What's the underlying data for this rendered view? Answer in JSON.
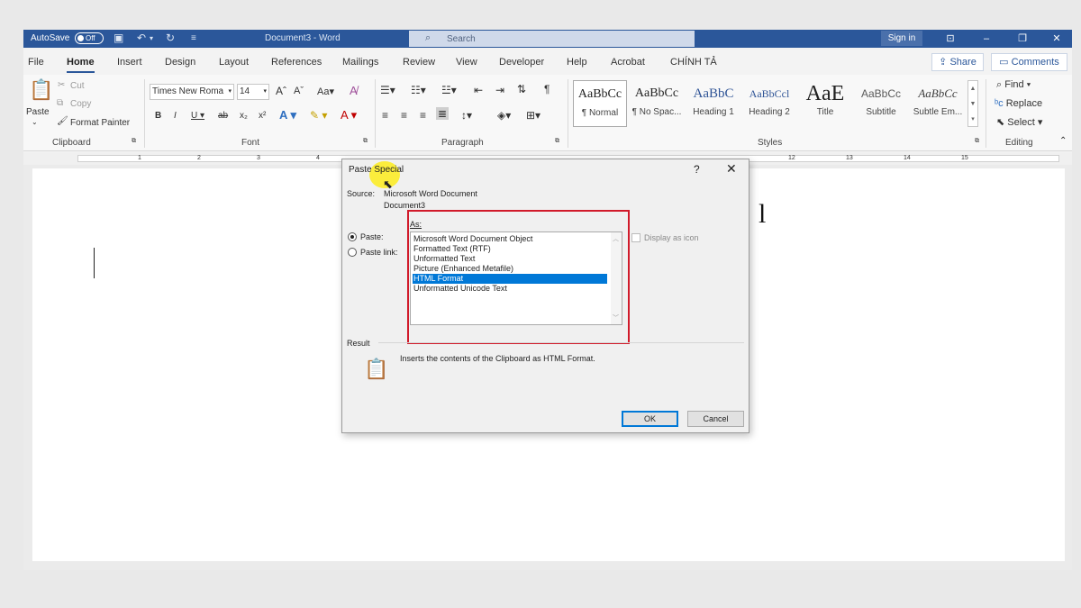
{
  "titlebar": {
    "autosave_label": "AutoSave",
    "autosave_state": "Off",
    "doc_title": "Document3 - Word",
    "search_placeholder": "Search",
    "signin_label": "Sign in"
  },
  "tabs": [
    "File",
    "Home",
    "Insert",
    "Design",
    "Layout",
    "References",
    "Mailings",
    "Review",
    "View",
    "Developer",
    "Help",
    "Acrobat",
    "CHÍNH TẢ"
  ],
  "active_tab": "Home",
  "share_label": "Share",
  "comments_label": "Comments",
  "ribbon": {
    "clipboard": {
      "paste": "Paste",
      "cut": "Cut",
      "copy": "Copy",
      "format_painter": "Format Painter",
      "group_label": "Clipboard"
    },
    "font": {
      "font_name": "Times New Roma",
      "font_size": "14",
      "group_label": "Font"
    },
    "paragraph": {
      "group_label": "Paragraph"
    },
    "styles": {
      "group_label": "Styles",
      "items": [
        {
          "preview": "AaBbCc",
          "name": "¶ Normal"
        },
        {
          "preview": "AaBbCc",
          "name": "¶ No Spac..."
        },
        {
          "preview": "AaBbC",
          "name": "Heading 1"
        },
        {
          "preview": "AaBbCcl",
          "name": "Heading 2"
        },
        {
          "preview": "AaE",
          "name": "Title"
        },
        {
          "preview": "AaBbCc",
          "name": "Subtitle"
        },
        {
          "preview": "AaBbCc",
          "name": "Subtle Em..."
        }
      ]
    },
    "editing": {
      "find": "Find",
      "replace": "Replace",
      "select": "Select",
      "group_label": "Editing"
    }
  },
  "ruler_numbers": [
    "1",
    "2",
    "3",
    "4",
    "12",
    "13",
    "14",
    "15"
  ],
  "document_text_fragment": "l",
  "dialog": {
    "title": "Paste Special",
    "source_label": "Source:",
    "source_value": "Microsoft Word Document",
    "source_doc": "Document3",
    "as_label": "As:",
    "paste_option": "Paste:",
    "paste_link_option": "Paste link:",
    "formats": [
      "Microsoft Word Document Object",
      "Formatted Text (RTF)",
      "Unformatted Text",
      "Picture (Enhanced Metafile)",
      "HTML Format",
      "Unformatted Unicode Text"
    ],
    "selected_format": "HTML Format",
    "display_as_icon": "Display as icon",
    "result_label": "Result",
    "result_text": "Inserts the contents of the Clipboard as HTML Format.",
    "ok_label": "OK",
    "cancel_label": "Cancel",
    "help_glyph": "?",
    "close_glyph": "✕"
  },
  "colors": {
    "title_bar": "#2b579a",
    "selection": "#0078d7",
    "highlight_box": "#d11a2a",
    "cursor_highlight": "#ffec00"
  }
}
